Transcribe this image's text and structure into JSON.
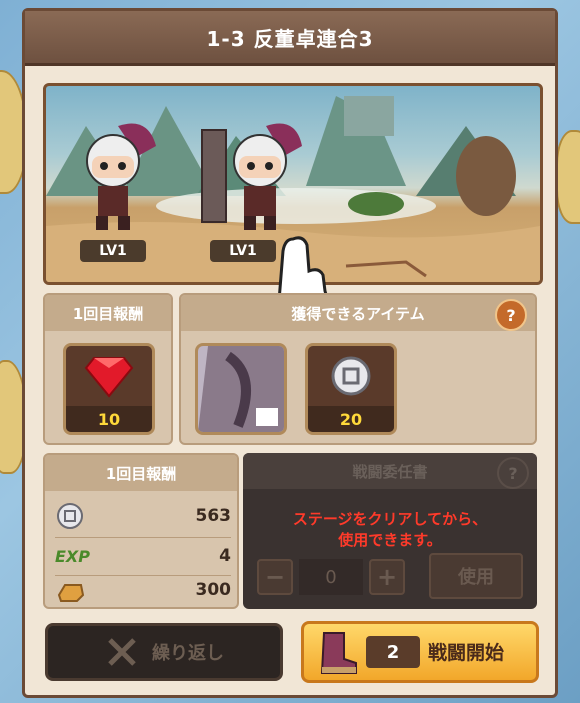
{
  "title": "1-3 反董卓連合3",
  "scene": {
    "units": [
      {
        "level": "LV1"
      },
      {
        "level": "LV1"
      }
    ]
  },
  "first_reward": {
    "header": "1回目報酬",
    "item": {
      "icon": "red-gem-icon",
      "count": "10"
    }
  },
  "obtainable_items": {
    "header": "獲得できるアイテム",
    "help": "?",
    "items": [
      {
        "icon": "character-fragment-icon",
        "count": ""
      },
      {
        "icon": "silver-coin-icon",
        "count": "20"
      }
    ]
  },
  "reward_list": {
    "header": "1回目報酬",
    "rows": [
      {
        "icon": "silver-coin-icon",
        "value": "563"
      },
      {
        "icon": "exp-icon",
        "label": "EXP",
        "value": "4"
      },
      {
        "icon": "gold-bar-icon",
        "value": "300"
      }
    ]
  },
  "delegation": {
    "header": "戦闘委任書",
    "help": "?",
    "message_line1": "ステージをクリアしてから、",
    "message_line2": "使用できます。",
    "minus": "−",
    "quantity": "0",
    "plus": "+",
    "use_label": "使用"
  },
  "buttons": {
    "repeat_label": "繰り返し",
    "start_cost": "2",
    "start_label": "戦闘開始"
  },
  "colors": {
    "accent": "#f2a72a",
    "warning_text": "#ff3a2a",
    "reward_count": "#ffd93a"
  }
}
